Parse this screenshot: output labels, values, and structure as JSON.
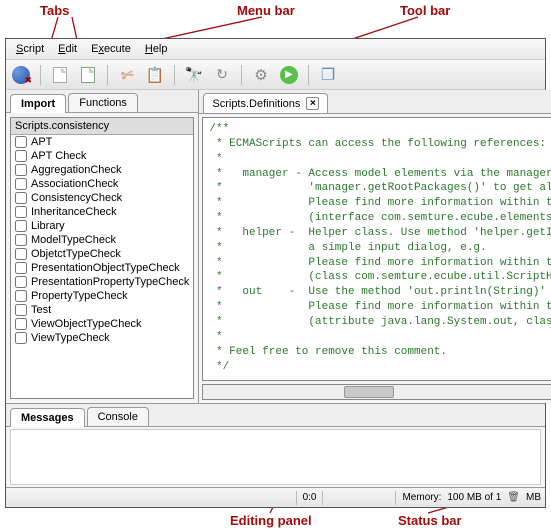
{
  "annotations": {
    "tabs": "Tabs",
    "menubar": "Menu bar",
    "toolbar": "Tool bar",
    "editing": "Editing panel",
    "statusbar": "Status bar"
  },
  "menu": {
    "script": "Script",
    "edit": "Edit",
    "execute": "Execute",
    "help": "Help"
  },
  "leftTabs": {
    "import": "Import",
    "functions": "Functions"
  },
  "tree": {
    "header": "Scripts.consistency",
    "items": [
      {
        "label": "APT"
      },
      {
        "label": "APT Check"
      },
      {
        "label": "AggregationCheck"
      },
      {
        "label": "AssociationCheck"
      },
      {
        "label": "ConsistencyCheck"
      },
      {
        "label": "InheritanceCheck"
      },
      {
        "label": "Library"
      },
      {
        "label": "ModelTypeCheck"
      },
      {
        "label": "ObjetctTypeCheck"
      },
      {
        "label": "PresentationObjectTypeCheck"
      },
      {
        "label": "PresentationPropertyTypeCheck"
      },
      {
        "label": "PropertyTypeCheck"
      },
      {
        "label": "Test"
      },
      {
        "label": "ViewObjectTypeCheck"
      },
      {
        "label": "ViewTypeCheck"
      }
    ]
  },
  "editorTab": {
    "title": "Scripts.Definitions"
  },
  "code": "/**\n * ECMAScripts can access the following references:\n *\n *   manager - Access model elements via the manager. Use m\n *             'manager.getRootPackages()' to get all root \n *             Please find more information within the api \n *             (interface com.semture.ecube.elements.Manage\n *   helper -  Helper class. Use method 'helper.getInput(St\n *             a simple input dialog, e.g.\n *             Please find more information within the api \n *             (class com.semture.ecube.util.ScriptHelper).\n *   out    -  Use the method 'out.println(String)' to prin\n *             Please find more information within the api \n *             (attribute java.lang.System.out, class java.\n *\n * Feel free to remove this comment.\n */",
  "bottomTabs": {
    "messages": "Messages",
    "console": "Console"
  },
  "status": {
    "pos": "0:0",
    "memory_label": "Memory:",
    "memory_value": "100 MB of 1",
    "memory_suffix": "MB"
  }
}
